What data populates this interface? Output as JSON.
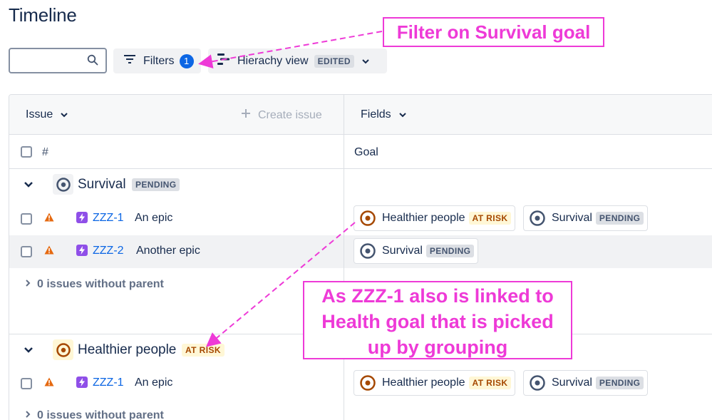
{
  "page": {
    "title": "Timeline"
  },
  "toolbar": {
    "search_placeholder": "",
    "filters_label": "Filters",
    "filters_count": "1",
    "view_label": "Hierachy view",
    "view_badge": "EDITED"
  },
  "table": {
    "issue_header": "Issue",
    "create_issue": "Create issue",
    "fields_header": "Fields",
    "hash_label": "#",
    "goal_column": "Goal",
    "groups": [
      {
        "name": "Survival",
        "status": "PENDING",
        "issues": [
          {
            "key": "ZZZ-1",
            "summary": "An epic",
            "goals": [
              {
                "name": "Healthier people",
                "status": "AT RISK"
              },
              {
                "name": "Survival",
                "status": "PENDING"
              }
            ]
          },
          {
            "key": "ZZZ-2",
            "summary": "Another epic",
            "goals": [
              {
                "name": "Survival",
                "status": "PENDING"
              }
            ]
          }
        ],
        "no_parent": "0 issues without parent"
      },
      {
        "name": "Healthier people",
        "status": "AT RISK",
        "issues": [
          {
            "key": "ZZZ-1",
            "summary": "An epic",
            "goals": [
              {
                "name": "Healthier people",
                "status": "AT RISK"
              },
              {
                "name": "Survival",
                "status": "PENDING"
              }
            ]
          }
        ],
        "no_parent": "0 issues without parent"
      }
    ]
  },
  "annotations": {
    "top": "Filter on Survival goal",
    "middle": [
      "As ZZZ-1 also is linked to",
      "Health goal that is picked",
      "up by grouping"
    ]
  },
  "colors": {
    "annotation": "#ee3ad7",
    "link": "#0c66e4",
    "at_risk_icon": "#a54800",
    "pending_icon": "#44546f",
    "epic": "#8f4fe8",
    "warning": "#e56910"
  }
}
